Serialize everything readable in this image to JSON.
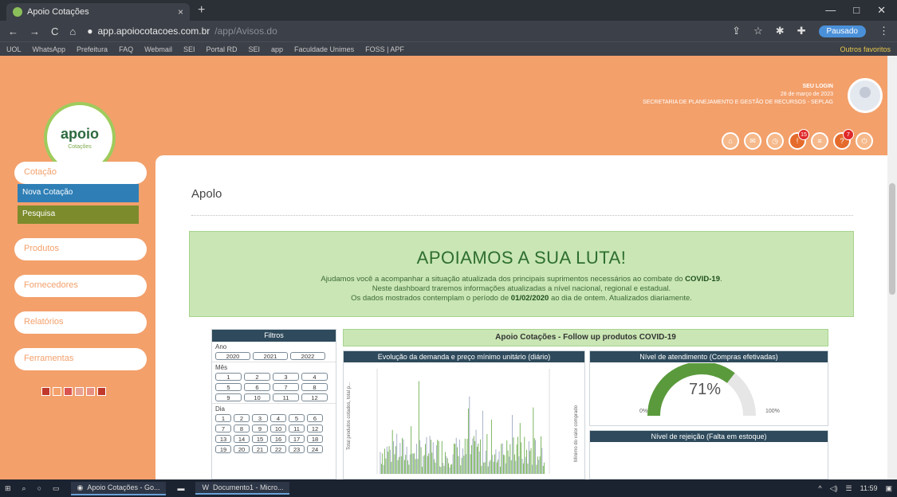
{
  "browser": {
    "tab_title": "Apoio Cotações",
    "tab_close": "×",
    "new_tab": "+",
    "window_controls": [
      "—",
      "□",
      "✕"
    ],
    "url_host": "app.apoiocotacoes.com.br",
    "url_path": "/app/Avisos.do",
    "profile_label": "Pausado",
    "bookmarks": [
      "UOL",
      "WhatsApp",
      "Prefeitura",
      "FAQ",
      "Webmail",
      "SEI",
      "Portal RD",
      "SEI",
      "app",
      "Faculdade Unimes",
      "FOSS | APF"
    ],
    "bookmarks_right": "Outros favoritos"
  },
  "header": {
    "logo_text": "apoio",
    "logo_sub": "Cotações",
    "user_name": "SEU LOGIN",
    "user_date": "28 de março de 2023",
    "user_org": "SECRETARIA DE PLANEJAMENTO E GESTÃO DE RECURSOS - SEPLAG",
    "icons": [
      {
        "name": "home-icon",
        "glyph": "⌂",
        "badge": ""
      },
      {
        "name": "mail-icon",
        "glyph": "✉",
        "badge": ""
      },
      {
        "name": "clock-icon",
        "glyph": "◷",
        "badge": ""
      },
      {
        "name": "bell-icon",
        "glyph": "!",
        "badge": "15"
      },
      {
        "name": "list-icon",
        "glyph": "≡",
        "badge": ""
      },
      {
        "name": "alert-icon",
        "glyph": "?",
        "badge": "7"
      },
      {
        "name": "logout-icon",
        "glyph": "⏻",
        "badge": ""
      }
    ]
  },
  "sidebar": {
    "cotacao": "Cotação",
    "nova_cotacao": "Nova Cotação",
    "pesquisa": "Pesquisa",
    "produtos": "Produtos",
    "fornecedores": "Fornecedores",
    "relatorios": "Relatórios",
    "ferramentas": "Ferramentas",
    "swatches": [
      "#c0392b",
      "#f3a06b",
      "#d9534f",
      "#e8a090",
      "#e89080",
      "#c0392b"
    ]
  },
  "main": {
    "title": "Apolo",
    "banner_heading": "APOIAMOS A SUA LUTA!",
    "banner_line1_a": "Ajudamos você a acompanhar a situação atualizada dos principais suprimentos necessários ao combate do ",
    "banner_line1_b": "COVID-19",
    "banner_line2": "Neste dashboard traremos informações atualizadas a nível nacional, regional e estadual.",
    "banner_line3_a": "Os dados mostrados contemplam o período de ",
    "banner_line3_b": "01/02/2020",
    "banner_line3_c": " ao dia de ontem. Atualizados diariamente."
  },
  "dashboard": {
    "filters_title": "Filtros",
    "ano_label": "Ano",
    "years": [
      "2020",
      "2021",
      "2022"
    ],
    "mes_label": "Mês",
    "months": [
      "1",
      "2",
      "3",
      "4",
      "5",
      "6",
      "7",
      "8",
      "9",
      "10",
      "11",
      "12"
    ],
    "dia_label": "Dia",
    "days": [
      "1",
      "2",
      "3",
      "4",
      "5",
      "6",
      "7",
      "8",
      "9",
      "10",
      "11",
      "12",
      "13",
      "14",
      "15",
      "16",
      "17",
      "18",
      "19",
      "20",
      "21",
      "22",
      "23",
      "24"
    ],
    "panel_title": "Apoio Cotações - Follow up produtos COVID-19",
    "chart1_title": "Evolução da demanda e preço mínimo unitário (diário)",
    "chart1_ylabel": "Total produtos cotados, total p...",
    "chart1_y2label": "Mínimo do valor comprado",
    "chart2_title": "Nível de atendimento (Compras efetivadas)",
    "gauge_value": "71%",
    "gauge_fraction": 0.71,
    "gauge_min": "0%",
    "gauge_max": "100%",
    "chart3_title": "Nível de rejeição (Falta em estoque)"
  },
  "taskbar": {
    "items": [
      "Apoio Cotações - Go...",
      "Documento1 - Micro..."
    ],
    "time": "11:59"
  }
}
